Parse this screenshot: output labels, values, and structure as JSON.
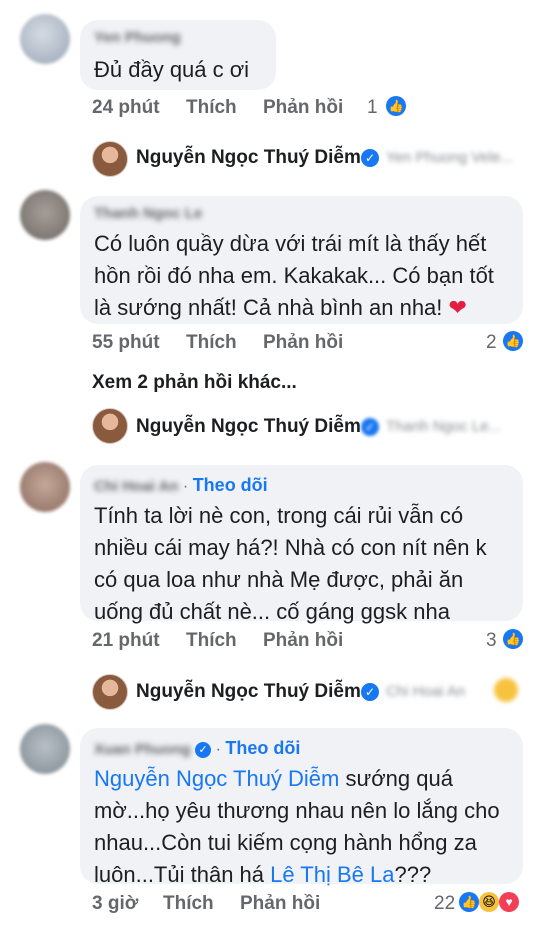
{
  "comments": [
    {
      "name_blurred": "Yen Phuong",
      "text": "Đủ đầy quá c ơi",
      "time": "24 phút",
      "like_label": "Thích",
      "reply_label": "Phản hồi",
      "reaction_count": "1",
      "avatar_color": "#b8c2cf"
    },
    {
      "name_blurred": "Thanh Ngoc Le",
      "text_lines": [
        "Có luôn quầy dừa với trái mít là thấy hết",
        "hồn rồi đó nha em. Kakakak... Có bạn tốt",
        "là sướng nhất! Cả nhà bình an nha!"
      ],
      "heart": "❤",
      "time": "55 phút",
      "like_label": "Thích",
      "reply_label": "Phản hồi",
      "reaction_count": "2",
      "avatar_color": "#8f8a86"
    },
    {
      "name_blurred": "Chi Hoai An",
      "follow_label": "Theo dõi",
      "text_lines": [
        "Tính ta lời nè con, trong cái rủi vẫn có",
        "nhiều cái may há?! Nhà có con nít nên k",
        "có qua loa như nhà Mẹ được, phải ăn",
        "uống đủ chất nè... cố gáng ggsk nha"
      ],
      "time": "21 phút",
      "like_label": "Thích",
      "reply_label": "Phản hồi",
      "reaction_count": "3",
      "avatar_color": "#a88a7b"
    },
    {
      "name_blurred": "Xuan Phuong",
      "follow_label": "Theo dõi",
      "mention_start": "Nguyễn Ngọc Thuý Diễm",
      "text_after_mention": " sướng quá",
      "text_lines": [
        "mờ...họ yêu thương nhau nên lo lắng cho",
        "nhau...Còn tui kiếm cọng hành hổng za"
      ],
      "last_line_prefix": "luôn...Tủi thân há ",
      "mention_end": "Lê Thị Bê La",
      "last_line_suffix": "???",
      "time": "3 giờ",
      "like_label": "Thích",
      "reply_label": "Phản hồi",
      "reaction_count": "22",
      "avatar_color": "#9aa5ad"
    }
  ],
  "replies": [
    {
      "author": "Nguyễn Ngọc Thuý Diễm",
      "blurred_target": "Yen Phuong Vele..."
    },
    {
      "author": "Nguyễn Ngọc Thuý Diễm",
      "blurred_target": "Thanh Ngoc Le..."
    },
    {
      "author": "Nguyễn Ngọc Thuý Diễm",
      "blurred_target": "Chi Hoai An"
    }
  ],
  "more_replies": "Xem 2 phản hồi khác...",
  "colors": {
    "accent": "#1877f2",
    "bubble": "#f0f2f5",
    "muted": "#65676b"
  }
}
